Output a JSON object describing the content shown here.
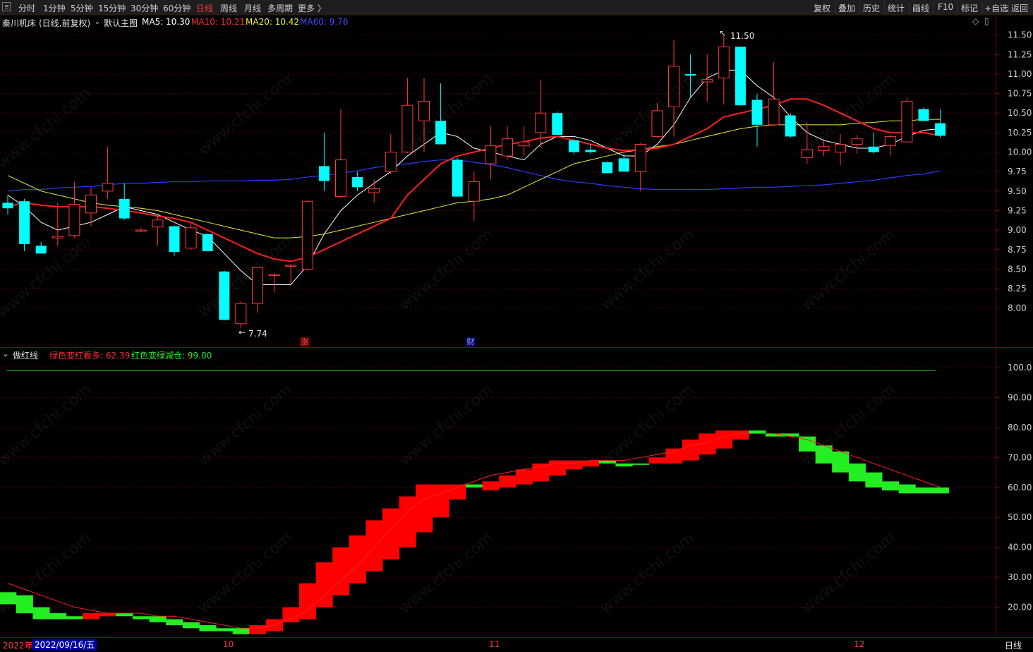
{
  "toolbar": {
    "periods": [
      "分时",
      "1分钟",
      "5分钟",
      "15分钟",
      "30分钟",
      "60分钟",
      "日线",
      "周线",
      "月线",
      "多周期",
      "更多 〉"
    ],
    "active_index": 6,
    "right_items": [
      "复权",
      "叠加",
      "历史",
      "统计",
      "画线",
      "F10",
      "标记",
      "+自选",
      "返回"
    ]
  },
  "main_panel": {
    "stock": "秦川机床",
    "period_label": "(日线,前复权)",
    "chart_name": "默认主图",
    "ma5": "MA5: 10.30",
    "ma10": "MA10: 10.21",
    "ma20": "MA20: 10.42",
    "ma60": "MA60: 9.76",
    "high_label": "11.50",
    "low_label": "7.74",
    "mark_zhang": "涨",
    "mark_cai": "财",
    "price_ticks": [
      "11.50",
      "11.25",
      "11.00",
      "10.75",
      "10.50",
      "10.25",
      "10.00",
      "9.75",
      "9.50",
      "9.25",
      "9.00",
      "8.75",
      "8.50",
      "8.25",
      "8.00"
    ]
  },
  "indicator_panel": {
    "name": "做红线",
    "green_to_red": "绿色变红看多: 62.39",
    "red_to_green": "红色变绿减仓: 99.00",
    "ticks": [
      "100.0",
      "90.00",
      "80.00",
      "70.00",
      "60.00",
      "50.00",
      "40.00",
      "30.00",
      "20.00"
    ]
  },
  "bottom": {
    "year_label": "2022年",
    "date_label": "2022/09/16/五",
    "month_10": "10",
    "month_11": "11",
    "month_12": "12",
    "period_right": "日线"
  },
  "watermark": "www.cfchi.com",
  "colors": {
    "up": "#ff3b3b",
    "down": "#00ffff",
    "ma5": "#ffffff",
    "ma10": "#ff2020",
    "ma20": "#e8e840",
    "ma60": "#2a3cff",
    "ind_red": "#ff0000",
    "ind_green": "#22ee22"
  },
  "chart_data": {
    "type": "candlestick",
    "candles": [
      {
        "o": 9.35,
        "h": 9.45,
        "l": 9.2,
        "c": 9.28
      },
      {
        "o": 9.37,
        "h": 9.4,
        "l": 8.73,
        "c": 8.82
      },
      {
        "o": 8.8,
        "h": 8.85,
        "l": 8.7,
        "c": 8.7
      },
      {
        "o": 8.9,
        "h": 9.35,
        "l": 8.8,
        "c": 8.92
      },
      {
        "o": 8.93,
        "h": 9.62,
        "l": 8.9,
        "c": 9.33
      },
      {
        "o": 9.22,
        "h": 9.55,
        "l": 9.05,
        "c": 9.45
      },
      {
        "o": 9.5,
        "h": 10.07,
        "l": 9.4,
        "c": 9.6
      },
      {
        "o": 9.4,
        "h": 9.6,
        "l": 9.13,
        "c": 9.15
      },
      {
        "o": 9.0,
        "h": 9.03,
        "l": 8.97,
        "c": 9.0
      },
      {
        "o": 9.04,
        "h": 9.18,
        "l": 8.8,
        "c": 9.13
      },
      {
        "o": 9.05,
        "h": 9.06,
        "l": 8.67,
        "c": 8.72
      },
      {
        "o": 8.77,
        "h": 9.1,
        "l": 8.75,
        "c": 9.03
      },
      {
        "o": 8.95,
        "h": 8.95,
        "l": 8.73,
        "c": 8.73
      },
      {
        "o": 8.47,
        "h": 8.48,
        "l": 7.85,
        "c": 7.85
      },
      {
        "o": 7.8,
        "h": 8.09,
        "l": 7.74,
        "c": 8.06
      },
      {
        "o": 8.06,
        "h": 8.52,
        "l": 7.94,
        "c": 8.52
      },
      {
        "o": 8.42,
        "h": 8.45,
        "l": 8.2,
        "c": 8.43
      },
      {
        "o": 8.55,
        "h": 8.57,
        "l": 8.3,
        "c": 8.55
      },
      {
        "o": 8.5,
        "h": 9.38,
        "l": 8.48,
        "c": 9.37
      },
      {
        "o": 9.82,
        "h": 10.25,
        "l": 9.5,
        "c": 9.63
      },
      {
        "o": 9.43,
        "h": 10.55,
        "l": 9.41,
        "c": 9.9
      },
      {
        "o": 9.68,
        "h": 9.75,
        "l": 9.5,
        "c": 9.55
      },
      {
        "o": 9.48,
        "h": 9.65,
        "l": 9.35,
        "c": 9.53
      },
      {
        "o": 9.75,
        "h": 10.23,
        "l": 9.72,
        "c": 10.0
      },
      {
        "o": 10.0,
        "h": 10.95,
        "l": 9.99,
        "c": 10.6
      },
      {
        "o": 10.4,
        "h": 10.95,
        "l": 10.0,
        "c": 10.65
      },
      {
        "o": 10.4,
        "h": 10.88,
        "l": 10.1,
        "c": 10.1
      },
      {
        "o": 9.9,
        "h": 9.92,
        "l": 9.43,
        "c": 9.43
      },
      {
        "o": 9.37,
        "h": 9.75,
        "l": 9.12,
        "c": 9.62
      },
      {
        "o": 9.85,
        "h": 10.33,
        "l": 9.65,
        "c": 10.08
      },
      {
        "o": 9.95,
        "h": 10.33,
        "l": 9.9,
        "c": 10.17
      },
      {
        "o": 10.08,
        "h": 10.33,
        "l": 9.95,
        "c": 10.13
      },
      {
        "o": 10.25,
        "h": 10.93,
        "l": 10.05,
        "c": 10.5
      },
      {
        "o": 10.5,
        "h": 10.52,
        "l": 10.22,
        "c": 10.22
      },
      {
        "o": 10.15,
        "h": 10.17,
        "l": 9.97,
        "c": 10.0
      },
      {
        "o": 10.03,
        "h": 10.1,
        "l": 9.98,
        "c": 10.0
      },
      {
        "o": 9.87,
        "h": 9.88,
        "l": 9.73,
        "c": 9.73
      },
      {
        "o": 9.92,
        "h": 9.98,
        "l": 9.75,
        "c": 9.75
      },
      {
        "o": 9.75,
        "h": 10.12,
        "l": 9.5,
        "c": 10.1
      },
      {
        "o": 10.2,
        "h": 10.63,
        "l": 10.18,
        "c": 10.53
      },
      {
        "o": 10.58,
        "h": 11.43,
        "l": 10.2,
        "c": 11.1
      },
      {
        "o": 11.0,
        "h": 11.25,
        "l": 10.7,
        "c": 10.98
      },
      {
        "o": 10.9,
        "h": 11.25,
        "l": 10.65,
        "c": 10.93
      },
      {
        "o": 10.95,
        "h": 11.5,
        "l": 10.61,
        "c": 11.35
      },
      {
        "o": 11.35,
        "h": 11.35,
        "l": 10.6,
        "c": 10.6
      },
      {
        "o": 10.67,
        "h": 10.75,
        "l": 10.07,
        "c": 10.35
      },
      {
        "o": 10.35,
        "h": 11.15,
        "l": 10.33,
        "c": 10.68
      },
      {
        "o": 10.47,
        "h": 10.5,
        "l": 10.18,
        "c": 10.2
      },
      {
        "o": 9.93,
        "h": 10.38,
        "l": 9.85,
        "c": 10.03
      },
      {
        "o": 10.02,
        "h": 10.17,
        "l": 9.95,
        "c": 10.07
      },
      {
        "o": 10.0,
        "h": 10.23,
        "l": 9.83,
        "c": 10.1
      },
      {
        "o": 10.1,
        "h": 10.22,
        "l": 9.98,
        "c": 10.17
      },
      {
        "o": 10.07,
        "h": 10.25,
        "l": 9.98,
        "c": 10.0
      },
      {
        "o": 10.08,
        "h": 10.22,
        "l": 9.95,
        "c": 10.2
      },
      {
        "o": 10.13,
        "h": 10.7,
        "l": 10.13,
        "c": 10.65
      },
      {
        "o": 10.55,
        "h": 10.57,
        "l": 10.4,
        "c": 10.4
      },
      {
        "o": 10.37,
        "h": 10.55,
        "l": 10.18,
        "c": 10.21
      }
    ],
    "ma5": [
      9.45,
      9.3,
      9.1,
      9.0,
      9.05,
      9.1,
      9.2,
      9.3,
      9.25,
      9.2,
      9.1,
      9.0,
      8.92,
      8.7,
      8.48,
      8.3,
      8.3,
      8.3,
      8.55,
      8.95,
      9.25,
      9.45,
      9.6,
      9.75,
      9.95,
      10.1,
      10.25,
      10.2,
      10.05,
      10.0,
      9.95,
      9.9,
      10.1,
      10.2,
      10.2,
      10.15,
      10.05,
      9.95,
      9.95,
      10.1,
      10.35,
      10.7,
      10.95,
      11.05,
      11.05,
      10.85,
      10.7,
      10.45,
      10.25,
      10.15,
      10.1,
      10.05,
      10.05,
      10.1,
      10.2,
      10.28,
      10.3
    ],
    "ma10": [
      9.3,
      9.35,
      9.32,
      9.3,
      9.3,
      9.3,
      9.28,
      9.25,
      9.22,
      9.18,
      9.15,
      9.1,
      9.0,
      8.9,
      8.8,
      8.7,
      8.63,
      8.6,
      8.65,
      8.75,
      8.85,
      8.95,
      9.05,
      9.15,
      9.45,
      9.65,
      9.85,
      9.95,
      10.0,
      10.05,
      10.1,
      10.13,
      10.18,
      10.2,
      10.15,
      10.1,
      10.05,
      10.02,
      10.03,
      10.05,
      10.1,
      10.2,
      10.3,
      10.45,
      10.5,
      10.55,
      10.6,
      10.68,
      10.68,
      10.6,
      10.5,
      10.4,
      10.3,
      10.25,
      10.25,
      10.25,
      10.21
    ],
    "ma20": [
      9.7,
      9.6,
      9.5,
      9.45,
      9.4,
      9.35,
      9.32,
      9.3,
      9.28,
      9.25,
      9.2,
      9.15,
      9.1,
      9.05,
      9.0,
      8.95,
      8.9,
      8.9,
      8.92,
      8.95,
      9.0,
      9.05,
      9.1,
      9.15,
      9.2,
      9.25,
      9.3,
      9.35,
      9.37,
      9.4,
      9.45,
      9.55,
      9.65,
      9.75,
      9.85,
      9.9,
      9.95,
      10.0,
      10.03,
      10.07,
      10.1,
      10.15,
      10.2,
      10.25,
      10.3,
      10.33,
      10.35,
      10.35,
      10.35,
      10.35,
      10.35,
      10.37,
      10.38,
      10.4,
      10.4,
      10.42,
      10.42
    ],
    "ma60": [
      9.5,
      9.52,
      9.52,
      9.54,
      9.55,
      9.56,
      9.58,
      9.6,
      9.6,
      9.61,
      9.62,
      9.62,
      9.63,
      9.63,
      9.63,
      9.64,
      9.64,
      9.65,
      9.68,
      9.7,
      9.73,
      9.76,
      9.8,
      9.83,
      9.85,
      9.88,
      9.9,
      9.9,
      9.87,
      9.84,
      9.8,
      9.75,
      9.7,
      9.65,
      9.62,
      9.6,
      9.57,
      9.55,
      9.53,
      9.52,
      9.52,
      9.52,
      9.52,
      9.53,
      9.54,
      9.55,
      9.55,
      9.56,
      9.57,
      9.58,
      9.6,
      9.62,
      9.64,
      9.67,
      9.7,
      9.72,
      9.76
    ],
    "indicator": [
      {
        "a": 25,
        "b": 21,
        "col": "g"
      },
      {
        "a": 24,
        "b": 18,
        "col": "g"
      },
      {
        "a": 20,
        "b": 16,
        "col": "g"
      },
      {
        "a": 18,
        "b": 16,
        "col": "g"
      },
      {
        "a": 17,
        "b": 16,
        "col": "g"
      },
      {
        "a": 18,
        "b": 16,
        "col": "r"
      },
      {
        "a": 18,
        "b": 17,
        "col": "r"
      },
      {
        "a": 18,
        "b": 17,
        "col": "g"
      },
      {
        "a": 17,
        "b": 16,
        "col": "g"
      },
      {
        "a": 17,
        "b": 15,
        "col": "g"
      },
      {
        "a": 16,
        "b": 14,
        "col": "g"
      },
      {
        "a": 15,
        "b": 13,
        "col": "g"
      },
      {
        "a": 14,
        "b": 12,
        "col": "g"
      },
      {
        "a": 13,
        "b": 12,
        "col": "g"
      },
      {
        "a": 13,
        "b": 11,
        "col": "g"
      },
      {
        "a": 14,
        "b": 11,
        "col": "r"
      },
      {
        "a": 16,
        "b": 12,
        "col": "r"
      },
      {
        "a": 20,
        "b": 15,
        "col": "r"
      },
      {
        "a": 28,
        "b": 16,
        "col": "r"
      },
      {
        "a": 35,
        "b": 20,
        "col": "r"
      },
      {
        "a": 40,
        "b": 24,
        "col": "r"
      },
      {
        "a": 44,
        "b": 28,
        "col": "r"
      },
      {
        "a": 49,
        "b": 32,
        "col": "r"
      },
      {
        "a": 53,
        "b": 36,
        "col": "r"
      },
      {
        "a": 57,
        "b": 40,
        "col": "r"
      },
      {
        "a": 61,
        "b": 45,
        "col": "r"
      },
      {
        "a": 61,
        "b": 50,
        "col": "r"
      },
      {
        "a": 61,
        "b": 56,
        "col": "r"
      },
      {
        "a": 60,
        "b": 61,
        "col": "g"
      },
      {
        "a": 62,
        "b": 59,
        "col": "r"
      },
      {
        "a": 64,
        "b": 60,
        "col": "r"
      },
      {
        "a": 66,
        "b": 61,
        "col": "r"
      },
      {
        "a": 68,
        "b": 62,
        "col": "r"
      },
      {
        "a": 69,
        "b": 64,
        "col": "r"
      },
      {
        "a": 69,
        "b": 66,
        "col": "r"
      },
      {
        "a": 69,
        "b": 67,
        "col": "r"
      },
      {
        "a": 68,
        "b": 69,
        "col": "g"
      },
      {
        "a": 68,
        "b": 67,
        "col": "g"
      },
      {
        "a": 68,
        "b": 68,
        "col": "g"
      },
      {
        "a": 70,
        "b": 68,
        "col": "r"
      },
      {
        "a": 73,
        "b": 68,
        "col": "r"
      },
      {
        "a": 76,
        "b": 69,
        "col": "r"
      },
      {
        "a": 78,
        "b": 71,
        "col": "r"
      },
      {
        "a": 79,
        "b": 73,
        "col": "r"
      },
      {
        "a": 79,
        "b": 76,
        "col": "r"
      },
      {
        "a": 79,
        "b": 78,
        "col": "g"
      },
      {
        "a": 78,
        "b": 77,
        "col": "g"
      },
      {
        "a": 78,
        "b": 77,
        "col": "g"
      },
      {
        "a": 77,
        "b": 72,
        "col": "g"
      },
      {
        "a": 74,
        "b": 68,
        "col": "g"
      },
      {
        "a": 72,
        "b": 65,
        "col": "g"
      },
      {
        "a": 68,
        "b": 62,
        "col": "g"
      },
      {
        "a": 65,
        "b": 60,
        "col": "g"
      },
      {
        "a": 62,
        "b": 59,
        "col": "g"
      },
      {
        "a": 61,
        "b": 58,
        "col": "g"
      },
      {
        "a": 60,
        "b": 58,
        "col": "g"
      },
      {
        "a": 60,
        "b": 58,
        "col": "g"
      }
    ],
    "indicator_line": [
      28,
      26,
      24,
      22,
      20,
      19,
      18,
      18,
      18,
      17,
      17,
      16,
      15,
      14,
      13,
      13,
      14,
      16,
      19,
      24,
      29,
      34,
      40,
      46,
      52,
      56,
      58,
      60,
      62,
      64,
      65,
      66,
      67,
      68,
      68,
      69,
      69,
      69,
      70,
      71,
      72,
      74,
      75,
      77,
      78,
      78,
      78,
      77,
      76,
      74,
      72,
      70,
      68,
      66,
      64,
      62,
      60
    ],
    "price_range": [
      7.5,
      11.75
    ],
    "indicator_range": [
      10,
      104
    ]
  }
}
